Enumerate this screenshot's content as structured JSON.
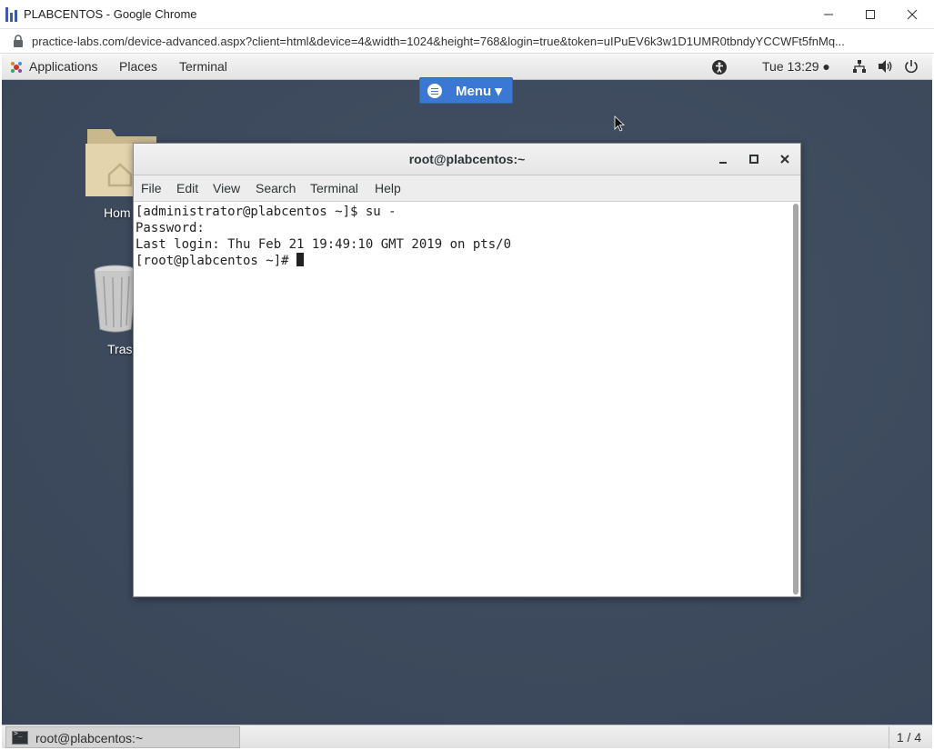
{
  "browser": {
    "window_title": "PLABCENTOS - Google Chrome",
    "url": "practice-labs.com/device-advanced.aspx?client=html&device=4&width=1024&height=768&login=true&token=uIPuEV6k3w1D1UMR0tbndyYCCWFt5fnMq..."
  },
  "topbar": {
    "applications": "Applications",
    "places": "Places",
    "terminal": "Terminal",
    "clock": "Tue 13:29 ●"
  },
  "menu_button": {
    "label": "Menu ▾"
  },
  "desktop_icons": {
    "home": "Hom",
    "trash": "Trasl"
  },
  "terminal_window": {
    "title": "root@plabcentos:~",
    "menus": [
      "File",
      "Edit",
      "View",
      "Search",
      "Terminal",
      "Help"
    ],
    "lines": [
      "[administrator@plabcentos ~]$ su -",
      "Password:",
      "Last login: Thu Feb 21 19:49:10 GMT 2019 on pts/0",
      "[root@plabcentos ~]# "
    ]
  },
  "taskbar": {
    "task_label": "root@plabcentos:~",
    "workspace": "1 / 4"
  }
}
